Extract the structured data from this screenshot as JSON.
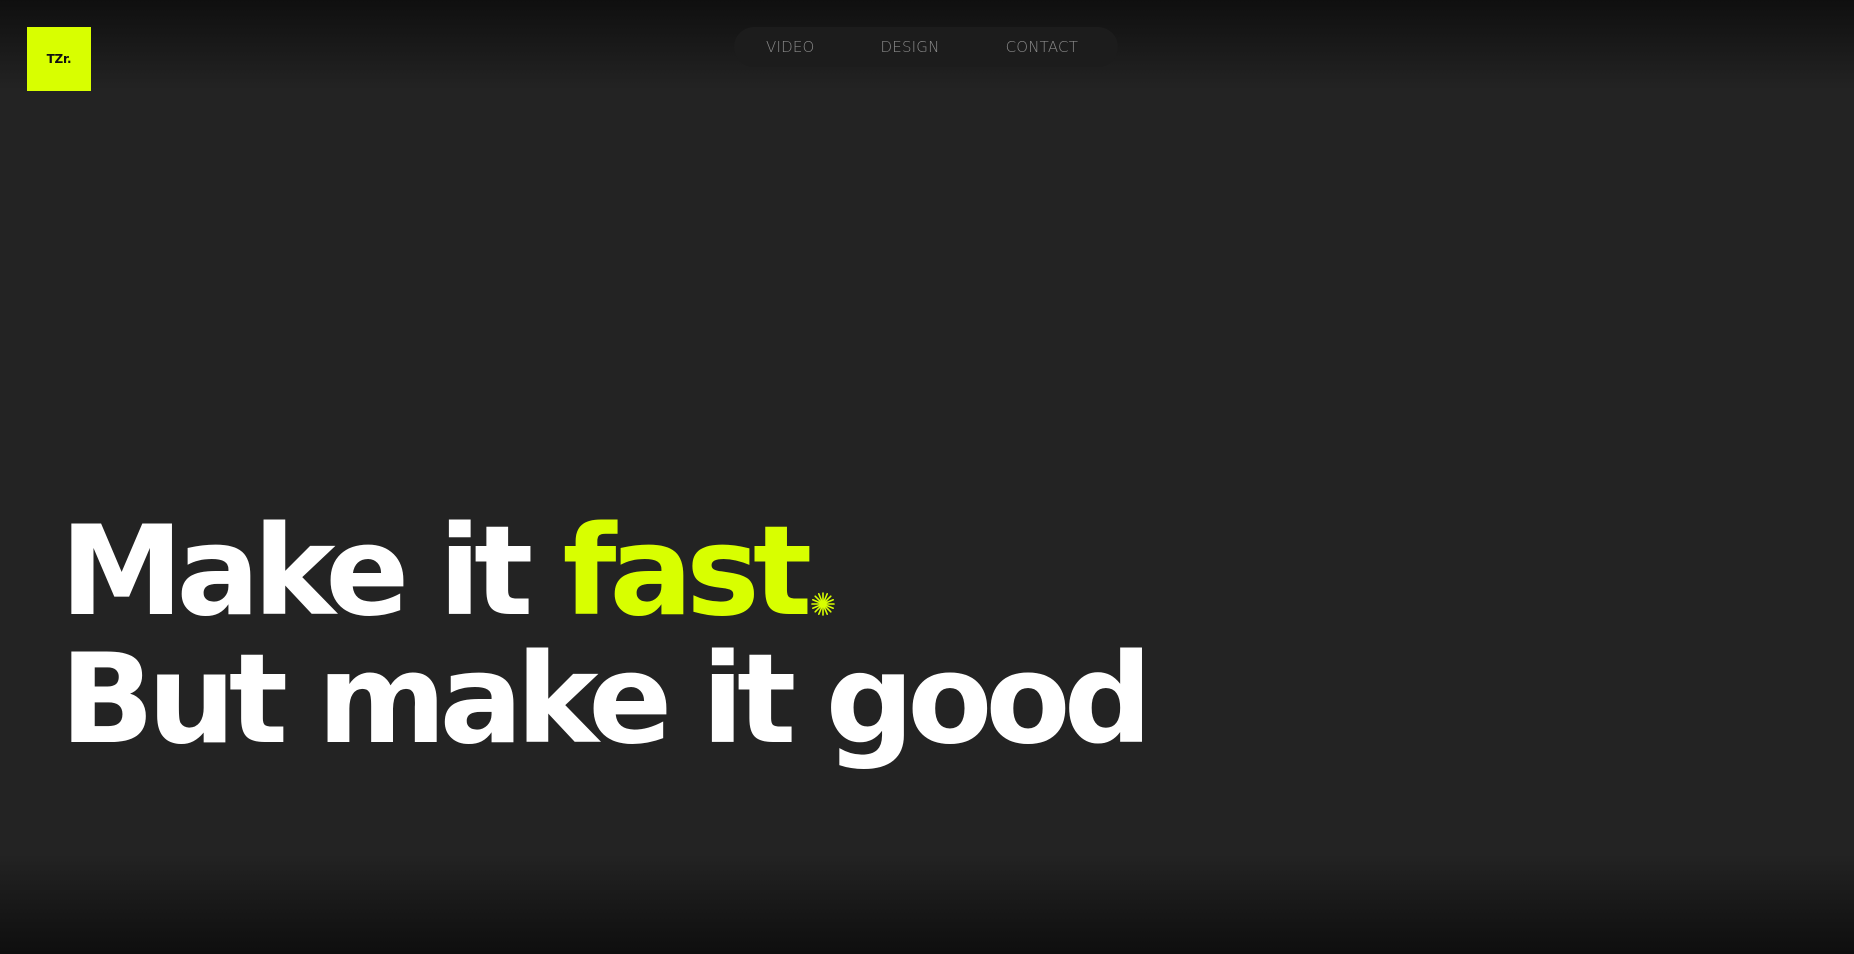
{
  "logo": {
    "text": "TZr."
  },
  "nav": {
    "items": [
      {
        "label": "VIDEO"
      },
      {
        "label": "DESIGN"
      },
      {
        "label": "CONTACT"
      }
    ]
  },
  "hero": {
    "line1_white": "Make it ",
    "line1_accent": "fast",
    "line2": "But make it good",
    "star_icon": "sparkle-icon"
  },
  "colors": {
    "background": "#232323",
    "accent": "#d8ff00",
    "text": "#ffffff",
    "nav_text": "#8a8a8a"
  }
}
